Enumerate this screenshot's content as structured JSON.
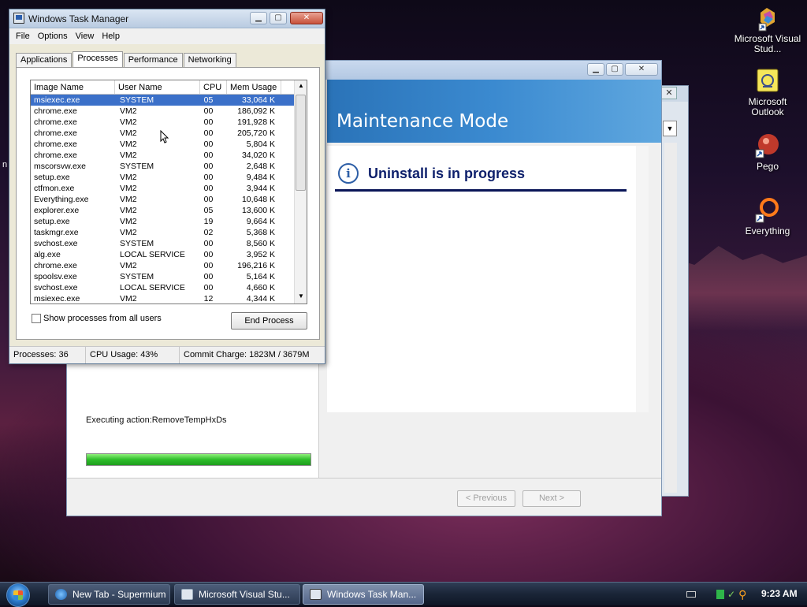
{
  "desktop": {
    "icons": [
      {
        "label": "Microsoft Visual Stud...",
        "icon": "visual-studio-icon"
      },
      {
        "label": "Microsoft Outlook",
        "icon": "outlook-icon"
      },
      {
        "label": "Pego",
        "icon": "pego-icon"
      },
      {
        "label": "Everything",
        "icon": "everything-icon"
      }
    ],
    "edge_glyph": "n"
  },
  "installer": {
    "banner_title": "Maintenance Mode",
    "heading": "Uninstall is in progress",
    "executing": "Executing action:RemoveTempHxDs",
    "progress": 1.0,
    "buttons": {
      "previous": "< Previous",
      "next": "Next >"
    }
  },
  "task_manager": {
    "title": "Windows Task Manager",
    "menu": [
      "File",
      "Options",
      "View",
      "Help"
    ],
    "tabs": [
      "Applications",
      "Processes",
      "Performance",
      "Networking"
    ],
    "active_tab": "Processes",
    "columns": [
      "Image Name",
      "User Name",
      "CPU",
      "Mem Usage"
    ],
    "rows": [
      {
        "name": "msiexec.exe",
        "user": "SYSTEM",
        "cpu": "05",
        "mem": "33,064 K",
        "selected": true
      },
      {
        "name": "chrome.exe",
        "user": "VM2",
        "cpu": "00",
        "mem": "186,092 K"
      },
      {
        "name": "chrome.exe",
        "user": "VM2",
        "cpu": "00",
        "mem": "191,928 K"
      },
      {
        "name": "chrome.exe",
        "user": "VM2",
        "cpu": "00",
        "mem": "205,720 K"
      },
      {
        "name": "chrome.exe",
        "user": "VM2",
        "cpu": "00",
        "mem": "5,804 K"
      },
      {
        "name": "chrome.exe",
        "user": "VM2",
        "cpu": "00",
        "mem": "34,020 K"
      },
      {
        "name": "mscorsvw.exe",
        "user": "SYSTEM",
        "cpu": "00",
        "mem": "2,648 K"
      },
      {
        "name": "setup.exe",
        "user": "VM2",
        "cpu": "00",
        "mem": "9,484 K"
      },
      {
        "name": "ctfmon.exe",
        "user": "VM2",
        "cpu": "00",
        "mem": "3,944 K"
      },
      {
        "name": "Everything.exe",
        "user": "VM2",
        "cpu": "00",
        "mem": "10,648 K"
      },
      {
        "name": "explorer.exe",
        "user": "VM2",
        "cpu": "05",
        "mem": "13,600 K"
      },
      {
        "name": "setup.exe",
        "user": "VM2",
        "cpu": "19",
        "mem": "9,664 K"
      },
      {
        "name": "taskmgr.exe",
        "user": "VM2",
        "cpu": "02",
        "mem": "5,368 K"
      },
      {
        "name": "svchost.exe",
        "user": "SYSTEM",
        "cpu": "00",
        "mem": "8,560 K"
      },
      {
        "name": "alg.exe",
        "user": "LOCAL SERVICE",
        "cpu": "00",
        "mem": "3,952 K"
      },
      {
        "name": "chrome.exe",
        "user": "VM2",
        "cpu": "00",
        "mem": "196,216 K"
      },
      {
        "name": "spoolsv.exe",
        "user": "SYSTEM",
        "cpu": "00",
        "mem": "5,164 K"
      },
      {
        "name": "svchost.exe",
        "user": "LOCAL SERVICE",
        "cpu": "00",
        "mem": "4,660 K"
      },
      {
        "name": "msiexec.exe",
        "user": "VM2",
        "cpu": "12",
        "mem": "4,344 K"
      }
    ],
    "show_all_label": "Show processes from all users",
    "end_process": "End Process",
    "status": {
      "processes": "Processes: 36",
      "cpu": "CPU Usage: 43%",
      "commit": "Commit Charge: 1823M / 3679M"
    }
  },
  "taskbar": {
    "items": [
      {
        "label": "New Tab - Supermium",
        "icon": "browser-icon",
        "active": false
      },
      {
        "label": "Microsoft Visual Stu...",
        "icon": "window-icon",
        "active": false
      },
      {
        "label": "Windows Task Man...",
        "icon": "task-manager-icon",
        "active": true
      }
    ],
    "clock": "9:23 AM"
  },
  "colors": {
    "selection": "#3b70c9",
    "banner": "#2a73b8",
    "heading": "#0d1f6b",
    "progress": "#2ebd2a"
  }
}
